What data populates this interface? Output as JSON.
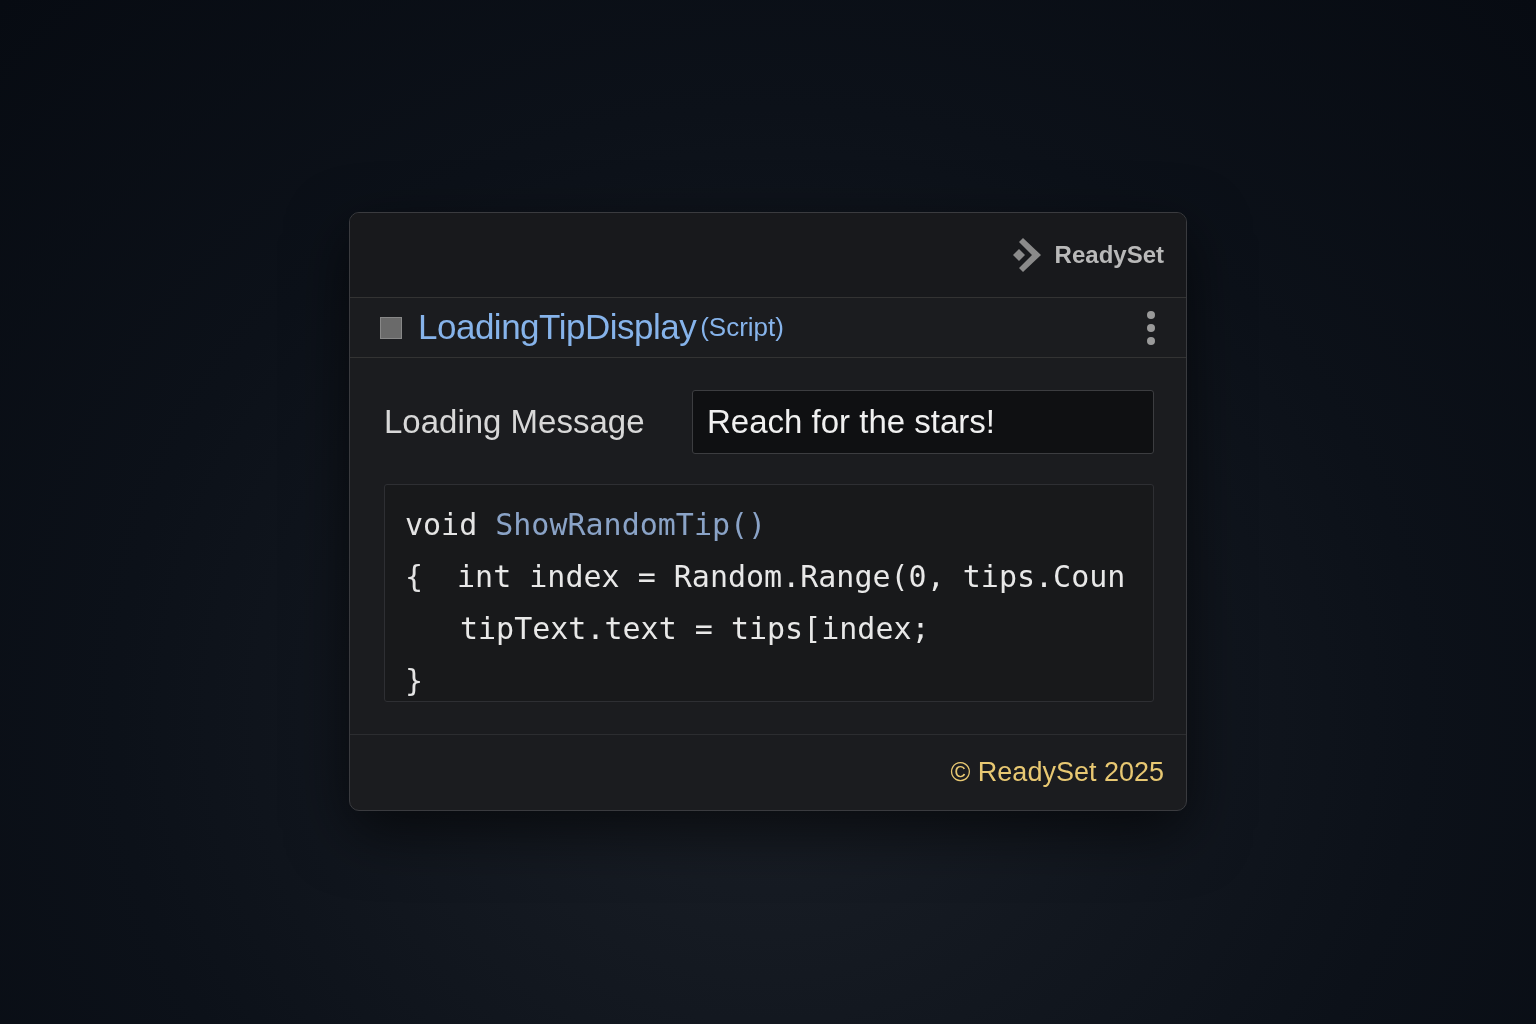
{
  "brand": {
    "name": "ReadySet"
  },
  "component": {
    "enabled": false,
    "name": "LoadingTipDisplay",
    "suffix": "(Script)"
  },
  "field": {
    "label": "Loading Message",
    "value": "Reach for the stars!"
  },
  "code": [
    {
      "tokens": [
        {
          "kind": "keyword",
          "text": "void"
        },
        {
          "kind": "function",
          "text": "ShowRandomTip()"
        }
      ]
    },
    {
      "tokens": [
        {
          "kind": "brace",
          "text": "{"
        },
        {
          "kind": "plain",
          "text": "int index = Random.Range(0, tips.Coun"
        }
      ]
    },
    {
      "tokens": [
        {
          "kind": "indent",
          "text": "tipText.text = tips[index;"
        }
      ]
    },
    {
      "tokens": [
        {
          "kind": "brace",
          "text": "}"
        }
      ]
    }
  ],
  "footer": {
    "text": "© ReadySet 2025"
  }
}
